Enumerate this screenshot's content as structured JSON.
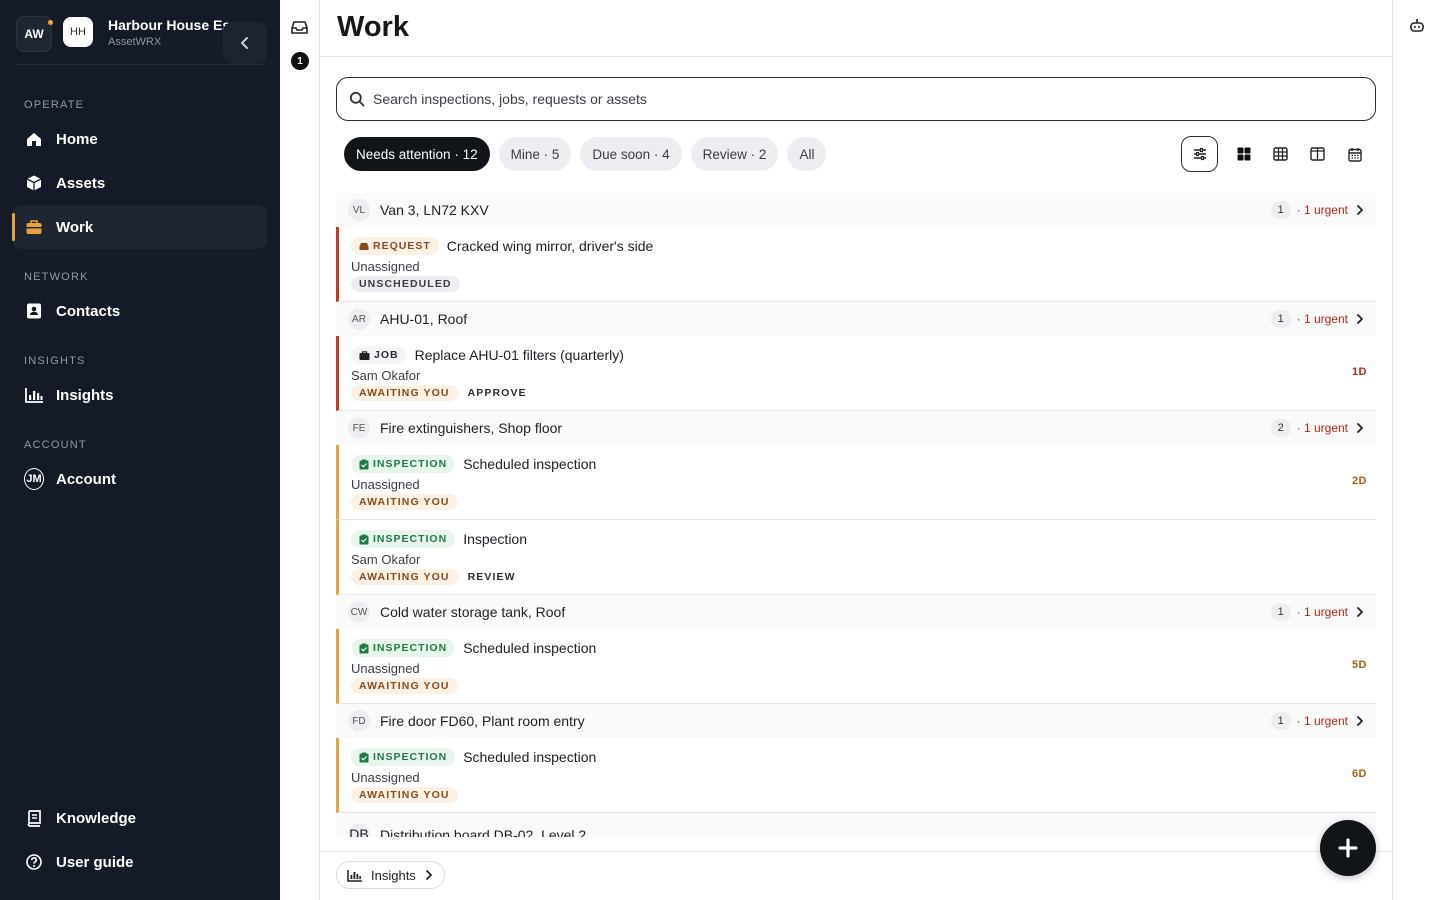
{
  "brand": {
    "logo": "AW",
    "org_initials": "HH",
    "org_name": "Harbour House Es...",
    "org_sub": "AssetWRX"
  },
  "sidebar": {
    "sections": {
      "operate": "OPERATE",
      "network": "NETWORK",
      "insights": "INSIGHTS",
      "account": "ACCOUNT"
    },
    "items": {
      "home": {
        "label": "Home",
        "icon": "home-icon"
      },
      "assets": {
        "label": "Assets",
        "icon": "box-icon"
      },
      "work": {
        "label": "Work",
        "icon": "briefcase-icon",
        "active": true
      },
      "contacts": {
        "label": "Contacts",
        "icon": "contact-book-icon"
      },
      "insights": {
        "label": "Insights",
        "icon": "bar-chart-icon"
      },
      "account": {
        "label": "Account",
        "initials": "JM"
      },
      "knowledge": {
        "label": "Knowledge",
        "icon": "book-icon"
      },
      "guide": {
        "label": "User guide",
        "icon": "help-icon"
      }
    }
  },
  "rail": {
    "inbox_count": "1"
  },
  "page": {
    "title": "Work"
  },
  "search": {
    "placeholder": "Search inspections, jobs, requests or assets"
  },
  "filters": [
    "Needs attention · 12",
    "Mine · 5",
    "Due soon · 4",
    "Review · 2",
    "All"
  ],
  "groups": [
    {
      "initials": "VL",
      "name": "Van 3, LN72 KXV",
      "count": "1",
      "urgent": "· 1 urgent",
      "items": [
        {
          "type": "REQUEST",
          "title": "Cracked wing mirror, driver's side",
          "assignee": "Unassigned",
          "tags": [
            "UNSCHEDULED"
          ],
          "due": ""
        }
      ]
    },
    {
      "initials": "AR",
      "name": "AHU-01, Roof",
      "count": "1",
      "urgent": "· 1 urgent",
      "items": [
        {
          "type": "JOB",
          "title": "Replace AHU-01 filters (quarterly)",
          "assignee": "Sam Okafor",
          "tags": [
            "AWAITING YOU",
            "APPROVE"
          ],
          "due": "1D"
        }
      ]
    },
    {
      "initials": "FE",
      "name": "Fire extinguishers, Shop floor",
      "count": "2",
      "urgent": "· 1 urgent",
      "items": [
        {
          "type": "INSPECTION",
          "title": "Scheduled inspection",
          "assignee": "Unassigned",
          "tags": [
            "AWAITING YOU"
          ],
          "due": "2D"
        },
        {
          "type": "INSPECTION",
          "title": "Inspection",
          "assignee": "Sam Okafor",
          "tags": [
            "AWAITING YOU",
            "REVIEW"
          ],
          "due": ""
        }
      ]
    },
    {
      "initials": "CW",
      "name": "Cold water storage tank, Roof",
      "count": "1",
      "urgent": "· 1 urgent",
      "items": [
        {
          "type": "INSPECTION",
          "title": "Scheduled inspection",
          "assignee": "Unassigned",
          "tags": [
            "AWAITING YOU"
          ],
          "due": "5D"
        }
      ]
    },
    {
      "initials": "FD",
      "name": "Fire door FD60, Plant room entry",
      "count": "1",
      "urgent": "· 1 urgent",
      "items": [
        {
          "type": "INSPECTION",
          "title": "Scheduled inspection",
          "assignee": "Unassigned",
          "tags": [
            "AWAITING YOU"
          ],
          "due": "6D"
        }
      ]
    }
  ],
  "peek_group": {
    "initials": "DB",
    "name": "Distribution board DB-02, Level 2"
  },
  "bottom": {
    "insights_label": "Insights"
  },
  "colors": {
    "sidebar_bg": "#141b26",
    "accent": "#e9a23b",
    "urgent": "#b0281e",
    "inspection": "#1f7a44"
  }
}
